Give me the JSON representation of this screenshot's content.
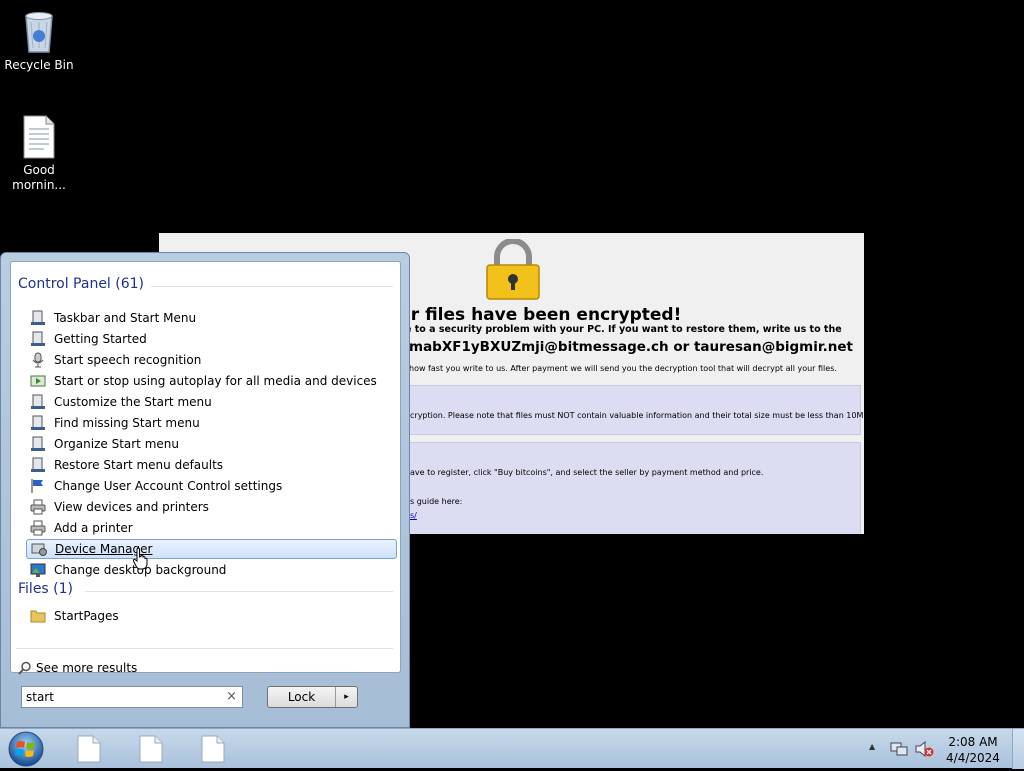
{
  "desktop": {
    "icons": [
      {
        "label": "Recycle Bin",
        "icon": "recycle-bin-icon"
      },
      {
        "label": "Good mornin...",
        "icon": "text-file-icon"
      }
    ]
  },
  "ransom_window": {
    "title": "our files have been encrypted!",
    "line1": "e to a security problem with your PC. If you want to restore them, write us to the",
    "emails": "mabXF1yBXUZmji@bitmessage.ch or tauresan@bigmir.net",
    "line2": "how fast you write to us. After payment we will send you the decryption tool that will decrypt all your files.",
    "panel1_text": "cryption. Please note that files must NOT contain valuable information and their total size must be less than 10Mb.",
    "panel2_text1": "ave to register, click \"Buy bitcoins\", and select the seller by payment method and price.",
    "panel2_text2": "s guide here:",
    "panel2_link": "s/"
  },
  "start_menu": {
    "groups": [
      {
        "header": "Control Panel (61)",
        "items": [
          {
            "label": "Taskbar and Start Menu",
            "icon": "taskbar-icon"
          },
          {
            "label": "Getting Started",
            "icon": "taskbar-icon"
          },
          {
            "label": "Start speech recognition",
            "icon": "microphone-icon"
          },
          {
            "label": "Start or stop using autoplay for all media and devices",
            "icon": "autoplay-icon"
          },
          {
            "label": "Customize the Start menu",
            "icon": "taskbar-icon"
          },
          {
            "label": "Find missing Start menu",
            "icon": "taskbar-icon"
          },
          {
            "label": "Organize Start menu",
            "icon": "taskbar-icon"
          },
          {
            "label": "Restore Start menu defaults",
            "icon": "taskbar-icon"
          },
          {
            "label": "Change User Account Control settings",
            "icon": "uac-flag-icon"
          },
          {
            "label": "View devices and printers",
            "icon": "printer-icon"
          },
          {
            "label": "Add a printer",
            "icon": "printer-icon"
          },
          {
            "label": "Device Manager",
            "icon": "device-manager-icon",
            "selected": true
          },
          {
            "label": "Change desktop background",
            "icon": "desktop-background-icon"
          }
        ]
      },
      {
        "header": "Files (1)",
        "items": [
          {
            "label": "StartPages",
            "icon": "folder-icon"
          }
        ]
      }
    ],
    "see_more": "See more results",
    "search_value": "start",
    "search_clear": "×",
    "lock_label": "Lock",
    "lock_arrow": "▸"
  },
  "taskbar": {
    "clock_time": "2:08 AM",
    "clock_date": "4/4/2024",
    "tray_up": "▲"
  }
}
